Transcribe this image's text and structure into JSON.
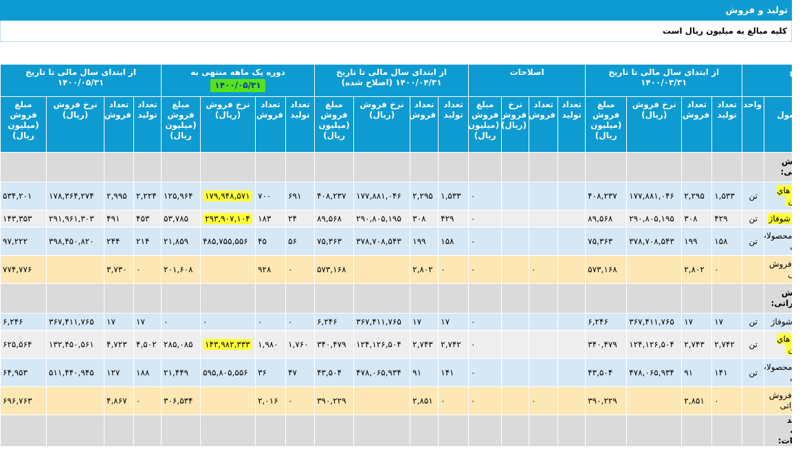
{
  "page_title": "تولید و فروش",
  "note": "کلیه مبالغ به میلیون ریال است",
  "group_headers": {
    "desc": "شرح",
    "g1_line1": "از ابتدای سال مالی تا تاریخ",
    "g1_line2": "۱۴۰۰/۰۳/۳۱",
    "g2": "اصلاحات",
    "g3_line1": "از ابتدای سال مالی تا تاریخ",
    "g3_line2": "۱۴۰۰/۰۴/۳۱ (اصلاح شده)",
    "g4_line1": "دوره یک ماهه منتهی به",
    "g4_line2": "۱۴۰۰/۰۵/۳۱",
    "g5_line1": "از ابتدای سال مالی تا تاریخ",
    "g5_line2": "۱۴۰۰/۰۵/۳۱"
  },
  "sub_headers": {
    "product": "نام محصول",
    "unit": "واحد",
    "prod_qty": "تعداد تولید",
    "sales_qty": "تعداد فروش",
    "rate": "نرخ فروش (ریال)",
    "amount": "مبلغ فروش (میلیون ریال)"
  },
  "rows": [
    {
      "type": "sec",
      "h": "h3",
      "name": "فروش داخلی:"
    },
    {
      "type": "r1",
      "h": "h1",
      "name": "لوله هاي نشكن",
      "unit": "تن",
      "hlname": true,
      "v": [
        "۱,۵۳۳",
        "۲,۲۹۵",
        "۱۷۷,۸۸۱,۰۴۶",
        "۴۰۸,۲۳۷",
        "",
        "",
        "",
        "۰",
        "۱,۵۳۳",
        "۲,۲۹۵",
        "۱۷۷,۸۸۱,۰۴۶",
        "۴۰۸,۲۳۷",
        "۶۹۱",
        "۷۰۰",
        "۱۷۹,۹۴۸,۵۷۱",
        "۱۲۵,۹۶۴",
        "۲,۲۲۴",
        "۲,۹۹۵",
        "۱۷۸,۳۶۴,۲۷۴",
        "۵۳۴,۲۰۱"
      ],
      "hl": [
        14
      ]
    },
    {
      "type": "r2",
      "h": "h2",
      "name": "ديگ شوفاژ",
      "unit": "تن",
      "hlname": true,
      "v": [
        "۴۲۹",
        "۳۰۸",
        "۲۹۰,۸۰۵,۱۹۵",
        "۸۹,۵۶۸",
        "",
        "",
        "",
        "۰",
        "۴۲۹",
        "۳۰۸",
        "۲۹۰,۸۰۵,۱۹۵",
        "۸۹,۵۶۸",
        "۲۴",
        "۱۸۳",
        "۲۹۳,۹۰۷,۱۰۴",
        "۵۳,۷۸۵",
        "۴۵۳",
        "۴۹۱",
        "۲۹۱,۹۶۱,۳۰۳",
        "۱۴۳,۳۵۳"
      ],
      "hl": [
        14
      ]
    },
    {
      "type": "r1",
      "h": "h1",
      "name": "سايرمحصولات چدني",
      "unit": "تن",
      "v": [
        "۱۵۸",
        "۱۹۹",
        "۳۷۸,۷۰۸,۵۴۳",
        "۷۵,۳۶۳",
        "",
        "",
        "",
        "۰",
        "۱۵۸",
        "۱۹۹",
        "۳۷۸,۷۰۸,۵۴۳",
        "۷۵,۳۶۳",
        "۵۶",
        "۴۵",
        "۴۸۵,۷۵۵,۵۵۶",
        "۲۱,۸۵۹",
        "۲۱۴",
        "۲۴۴",
        "۳۹۸,۴۵۰,۸۲۰",
        "۹۷,۲۲۲"
      ]
    },
    {
      "type": "tot",
      "h": "h1",
      "name": "جمع فروش داخلی",
      "unit": "",
      "v": [
        "۰",
        "۲,۸۰۲",
        "",
        "۵۷۳,۱۶۸",
        "",
        "۰",
        "",
        "۰",
        "۰",
        "۲,۸۰۲",
        "",
        "۵۷۳,۱۶۸",
        "۰",
        "۹۲۸",
        "",
        "۲۰۱,۶۰۸",
        "۰",
        "۳,۷۳۰",
        "",
        "۷۷۴,۷۷۶"
      ]
    },
    {
      "type": "sec",
      "h": "h3",
      "name": "فروش صادراتی:"
    },
    {
      "type": "r1",
      "h": "h2",
      "name": "ديگ شوفاژ",
      "unit": "تن",
      "v": [
        "۱۷",
        "۱۷",
        "۳۶۷,۴۱۱,۷۶۵",
        "۶,۲۴۶",
        "",
        "",
        "",
        "۰",
        "۱۷",
        "۱۷",
        "۳۶۷,۴۱۱,۷۶۵",
        "۶,۲۴۶",
        "۰",
        "۰",
        "۰",
        "۰",
        "۱۷",
        "۱۷",
        "۳۶۷,۴۱۱,۷۶۵",
        "۶,۲۴۶"
      ]
    },
    {
      "type": "r2",
      "h": "h1",
      "name": "لوله هاي نشكن",
      "unit": "تن",
      "hlname": true,
      "v": [
        "۲,۷۴۲",
        "۲,۷۴۳",
        "۱۲۴,۱۲۶,۵۰۴",
        "۳۴۰,۴۷۹",
        "",
        "",
        "",
        "۰",
        "۲,۷۴۲",
        "۲,۷۴۳",
        "۱۲۴,۱۲۶,۵۰۴",
        "۳۴۰,۴۷۹",
        "۱,۷۶۰",
        "۱,۹۸۰",
        "۱۴۳,۹۸۲,۳۳۳",
        "۲۸۵,۰۸۵",
        "۴,۵۰۲",
        "۴,۷۲۳",
        "۱۳۲,۴۵۰,۵۶۱",
        "۶۲۵,۵۶۴"
      ],
      "hl": [
        14
      ]
    },
    {
      "type": "r1",
      "h": "h1",
      "name": "سايرمحصولات چدني",
      "unit": "تن",
      "v": [
        "۱۴۱",
        "۹۱",
        "۴۷۸,۰۶۵,۹۳۴",
        "۴۳,۵۰۴",
        "",
        "",
        "",
        "۰",
        "۱۴۱",
        "۹۱",
        "۴۷۸,۰۶۵,۹۳۴",
        "۴۳,۵۰۴",
        "۴۷",
        "۳۶",
        "۵۹۵,۸۰۵,۵۵۶",
        "۲۱,۴۴۹",
        "۱۸۸",
        "۱۲۷",
        "۵۱۱,۴۴۰,۹۴۵",
        "۶۴,۹۵۳"
      ]
    },
    {
      "type": "tot",
      "h": "h1",
      "name": "جمع فروش صادراتی",
      "unit": "",
      "v": [
        "۰",
        "۲,۸۵۱",
        "",
        "۳۹۰,۲۲۹",
        "",
        "۰",
        "",
        "۰",
        "۰",
        "۲,۸۵۱",
        "",
        "۳۹۰,۲۲۹",
        "۰",
        "۲,۰۱۶",
        "",
        "۳۰۶,۵۳۴",
        "۰",
        "۴,۸۶۷",
        "",
        "۶۹۶,۷۶۳"
      ]
    },
    {
      "type": "sec",
      "h": "h3",
      "name": "درآمد ارائه خدمات:"
    }
  ]
}
